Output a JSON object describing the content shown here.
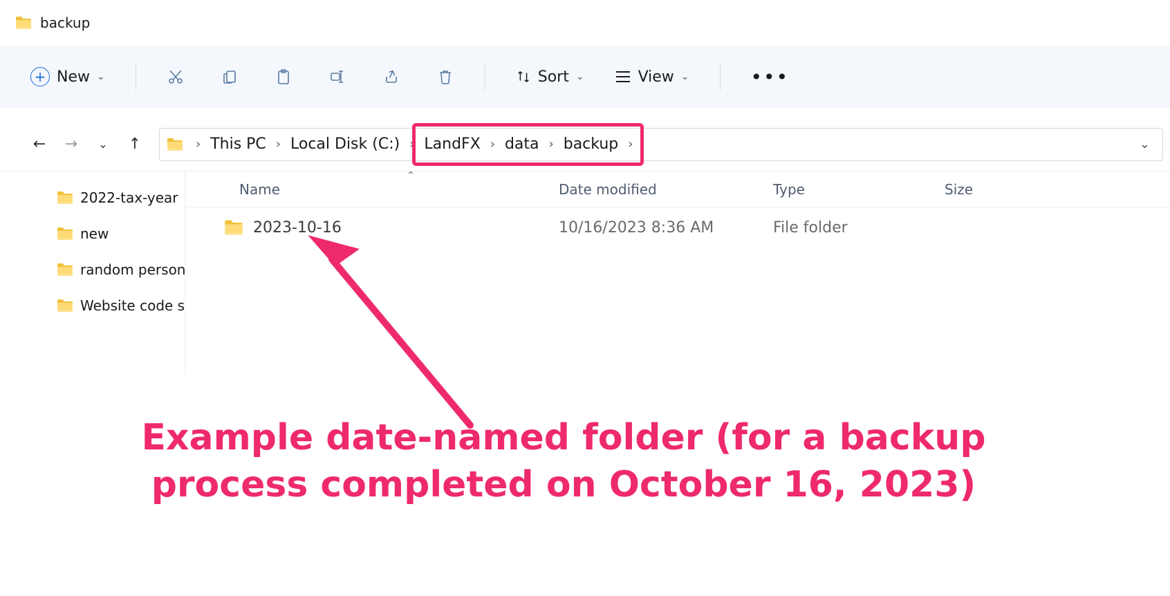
{
  "window": {
    "title": "backup"
  },
  "toolbar": {
    "new_label": "New",
    "sort_label": "Sort",
    "view_label": "View"
  },
  "breadcrumb": {
    "sep": "›",
    "items": [
      "This PC",
      "Local Disk (C:)",
      "LandFX",
      "data",
      "backup"
    ]
  },
  "sidebar": {
    "items": [
      {
        "label": "2022-tax-year"
      },
      {
        "label": "new"
      },
      {
        "label": "random personal"
      },
      {
        "label": "Website code stuff"
      }
    ]
  },
  "columns": {
    "name": "Name",
    "date": "Date modified",
    "type": "Type",
    "size": "Size"
  },
  "rows": [
    {
      "name": "2023-10-16",
      "date": "10/16/2023 8:36 AM",
      "type": "File folder",
      "size": ""
    }
  ],
  "annotation": {
    "text": "Example date-named folder (for a backup process completed on October  16, 2023)"
  }
}
